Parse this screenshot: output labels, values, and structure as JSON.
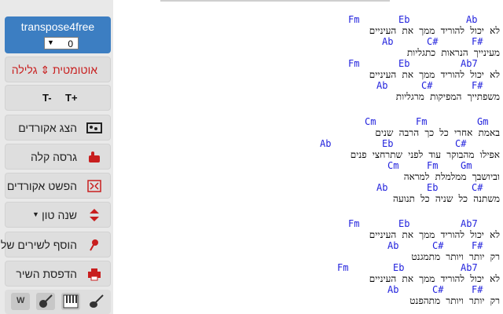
{
  "sidebar": {
    "brand": "transpose4free",
    "transpose_value": "0",
    "scroll_label": "גלילה אוטומטית",
    "font_smaller": "T-",
    "font_larger": "T+",
    "buttons": [
      {
        "label": "הצג אקורדים",
        "icon": "chord-diagram-icon"
      },
      {
        "label": "גרסה קלה",
        "icon": "thumbs-up-icon"
      },
      {
        "label": "הפשט אקורדים",
        "icon": "simplify-icon"
      },
      {
        "label": "שנה טון",
        "icon": "tone-arrows-icon"
      },
      {
        "label": "הוסף לשירים שלי",
        "icon": "pin-icon"
      },
      {
        "label": "הדפסת השיר",
        "icon": "printer-icon"
      }
    ],
    "bottom_icons": [
      "word-icon",
      "guitar-icon",
      "piano-icon",
      "electric-guitar-icon"
    ]
  },
  "song": {
    "blocks": [
      [
        {
          "chords": [
            [
              "Fm",
              443
            ],
            [
              "Eb",
              507
            ],
            [
              "Ab",
              593
            ]
          ],
          "text": "לא יכול להוריד ממך את העיניים"
        },
        {
          "chords": [
            [
              "Ab",
              486
            ],
            [
              "C#",
              543
            ],
            [
              "F#",
              600
            ]
          ],
          "text": "מעינייך הנראות כתגליות"
        },
        {
          "chords": [
            [
              "Fm",
              443
            ],
            [
              "Eb",
              507
            ],
            [
              "Ab7",
              586
            ]
          ],
          "text": "לא יכול להוריד ממך את העיניים"
        },
        {
          "chords": [
            [
              "Ab",
              479
            ],
            [
              "C#",
              536
            ],
            [
              "F#",
              600
            ]
          ],
          "text": "משפתייך המפיקות מרגליות"
        }
      ],
      [
        {
          "chords": [
            [
              "Cm",
              464
            ],
            [
              "Fm",
              529
            ],
            [
              "Gm",
              607
            ]
          ],
          "text": "באמת אחרי כל כך הרבה שנים"
        },
        {
          "chords": [
            [
              "Ab",
              407
            ],
            [
              "Eb",
              486
            ],
            [
              "C#",
              579
            ]
          ],
          "text": "אפילו מהבוקר עוד לפני שתרחצי פנים"
        },
        {
          "chords": [
            [
              "Cm",
              493
            ],
            [
              "Fm",
              543
            ],
            [
              "Gm",
              586
            ]
          ],
          "text": "וביושבך ממלמלת למראה"
        },
        {
          "chords": [
            [
              "Ab",
              479
            ],
            [
              "Eb",
              543
            ],
            [
              "C#",
              600
            ]
          ],
          "text": "משתנה כל שניה כל תנועה"
        }
      ],
      [
        {
          "chords": [
            [
              "Fm",
              443
            ],
            [
              "Eb",
              507
            ],
            [
              "Ab7",
              586
            ]
          ],
          "text": "לא יכול להוריד ממך את העיניים"
        },
        {
          "chords": [
            [
              "Ab",
              493
            ],
            [
              "C#",
              550
            ],
            [
              "F#",
              600
            ]
          ],
          "text": "רק יותר ויותר מתמגנט"
        },
        {
          "chords": [
            [
              "Fm",
              429
            ],
            [
              "Eb",
              500
            ],
            [
              "Ab7",
              586
            ]
          ],
          "text": "לא יכול להוריד ממך את העיניים"
        },
        {
          "chords": [
            [
              "Ab",
              493
            ],
            [
              "C#",
              550
            ],
            [
              "F#",
              600
            ]
          ],
          "text": "רק יותר ויותר מתהפנט"
        }
      ]
    ]
  },
  "colors": {
    "brand": "#3c7ec2",
    "chord": "#2222dd",
    "scroll": "#c81e1e"
  }
}
